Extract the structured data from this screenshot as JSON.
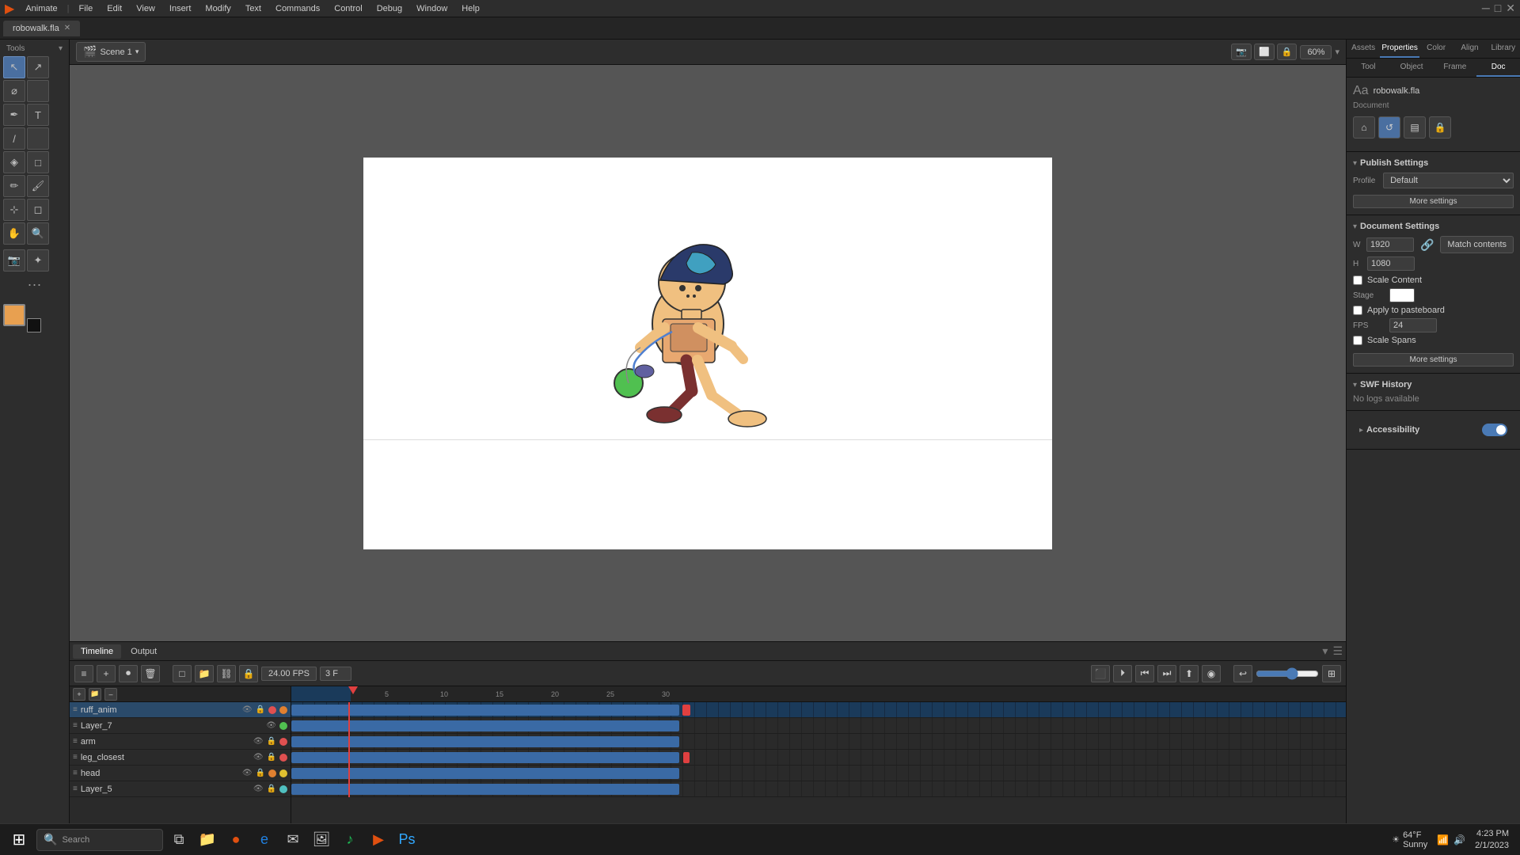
{
  "app": {
    "name": "Animate",
    "file_tab": "robowalk.fla",
    "scene": "Scene 1",
    "zoom": "60%"
  },
  "menu": {
    "items": [
      "File",
      "Edit",
      "View",
      "Insert",
      "Modify",
      "Text",
      "Commands",
      "Control",
      "Debug",
      "Window",
      "Help"
    ]
  },
  "toolbar": {
    "scene_label": "Scene 1"
  },
  "right_panel": {
    "tabs": [
      "Assets",
      "Properties",
      "Color",
      "Align",
      "Library"
    ],
    "active_tab": "Properties",
    "doc_tabs": [
      "Tool",
      "Object",
      "Frame",
      "Doc"
    ],
    "active_doc_tab": "Doc",
    "file_label": "robowalk.fla",
    "document_label": "Document",
    "doc_icons": [
      "⌂",
      "↺",
      "▤",
      "🔒"
    ],
    "publish_settings": {
      "title": "Publish Settings",
      "profile_label": "Profile",
      "profile_value": "Default",
      "more_settings_btn": "More settings"
    },
    "document_settings": {
      "title": "Document Settings",
      "width_label": "W",
      "width_value": "1920",
      "height_label": "H",
      "height_value": "1080",
      "match_contents_btn": "Match contents",
      "scale_content_label": "Scale Content",
      "apply_pasteboard_label": "Apply to pasteboard",
      "scale_spans_label": "Scale Spans",
      "stage_label": "Stage",
      "fps_label": "FPS",
      "fps_value": "24",
      "more_settings_btn2": "More settings"
    },
    "swf_history": {
      "title": "SWF History",
      "empty_msg": "No logs available"
    },
    "accessibility": {
      "title": "Accessibility"
    }
  },
  "timeline": {
    "tab_timeline": "Timeline",
    "tab_output": "Output",
    "fps": "24.00",
    "fps_unit": "FPS",
    "frame": "3",
    "frame_unit": "F",
    "layers": [
      {
        "name": "ruff_anim",
        "dot_color": "red",
        "has_lock": true,
        "selected": true
      },
      {
        "name": "Layer_7",
        "dot_color": "green",
        "has_lock": false,
        "selected": false
      },
      {
        "name": "arm",
        "dot_color": "red",
        "has_lock": true,
        "selected": false
      },
      {
        "name": "leg_closest",
        "dot_color": "red",
        "has_lock": true,
        "selected": false
      },
      {
        "name": "head",
        "dot_color": "orange",
        "has_lock": true,
        "selected": false
      },
      {
        "name": "Layer_5",
        "dot_color": "teal",
        "has_lock": true,
        "selected": false
      }
    ],
    "frame_markers": [
      "5",
      "10",
      "15",
      "20",
      "25",
      "30"
    ]
  },
  "taskbar": {
    "search_label": "Search",
    "time": "4:23 PM",
    "date": "2/1/2023",
    "weather": "64°F",
    "weather_desc": "Sunny"
  }
}
